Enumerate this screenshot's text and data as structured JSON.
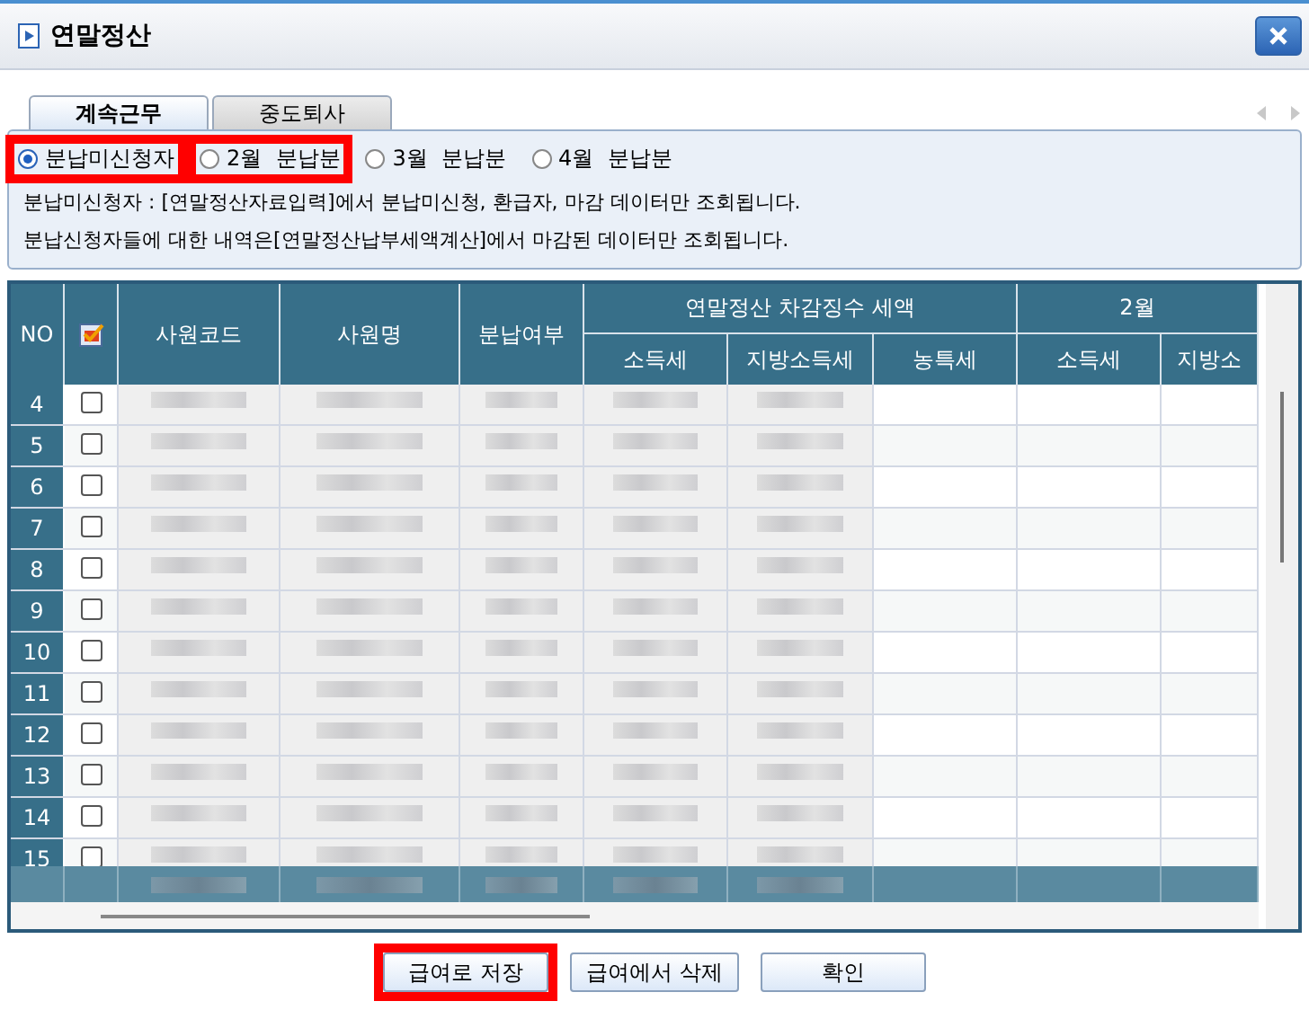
{
  "window": {
    "title": "연말정산"
  },
  "tabs": [
    {
      "label": "계속근무",
      "selected": true
    },
    {
      "label": "중도퇴사",
      "selected": false
    }
  ],
  "options": [
    {
      "label": "분납미신청자",
      "selected": true,
      "highlighted": true
    },
    {
      "label": "2월  분납분",
      "selected": false,
      "highlighted": true
    },
    {
      "label": "3월  분납분",
      "selected": false,
      "highlighted": false
    },
    {
      "label": "4월  분납분",
      "selected": false,
      "highlighted": false
    }
  ],
  "notes": [
    "분납미신청자 : [연말정산자료입력]에서 분납미신청, 환급자, 마감 데이터만 조회됩니다.",
    "분납신청자들에 대한 내역은[연말정산납부세액계산]에서 마감된 데이터만 조회됩니다."
  ],
  "table": {
    "columns": [
      {
        "label": "NO",
        "kind": "no"
      },
      {
        "kind": "check"
      },
      {
        "label": "사원코드",
        "kind": "text"
      },
      {
        "label": "사원명",
        "kind": "text"
      },
      {
        "label": "분납여부",
        "kind": "text"
      },
      {
        "label": "연말정산 차감징수 세액",
        "kind": "group",
        "columns": [
          {
            "label": "소득세",
            "kind": "text"
          },
          {
            "label": "지방소득세",
            "kind": "text"
          },
          {
            "label": "농특세",
            "kind": "empty"
          }
        ]
      },
      {
        "label": "2월",
        "kind": "group",
        "columns": [
          {
            "label": "소득세",
            "kind": "empty"
          },
          {
            "label": "지방소",
            "kind": "empty"
          }
        ]
      }
    ],
    "rows": [
      {
        "no": "4",
        "checked": false,
        "blurred": true
      },
      {
        "no": "5",
        "checked": false,
        "blurred": true
      },
      {
        "no": "6",
        "checked": false,
        "blurred": true
      },
      {
        "no": "7",
        "checked": false,
        "blurred": true
      },
      {
        "no": "8",
        "checked": false,
        "blurred": true
      },
      {
        "no": "9",
        "checked": false,
        "blurred": true
      },
      {
        "no": "10",
        "checked": false,
        "blurred": true
      },
      {
        "no": "11",
        "checked": false,
        "blurred": true
      },
      {
        "no": "12",
        "checked": false,
        "blurred": true
      },
      {
        "no": "13",
        "checked": false,
        "blurred": true
      },
      {
        "no": "14",
        "checked": false,
        "blurred": true
      },
      {
        "no": "15",
        "checked": false,
        "blurred": true
      }
    ],
    "summary": {
      "blurred": true
    }
  },
  "buttons": [
    {
      "label": "급여로 저장",
      "highlighted": true
    },
    {
      "label": "급여에서 삭제",
      "highlighted": false
    },
    {
      "label": "확인",
      "highlighted": false
    }
  ]
}
